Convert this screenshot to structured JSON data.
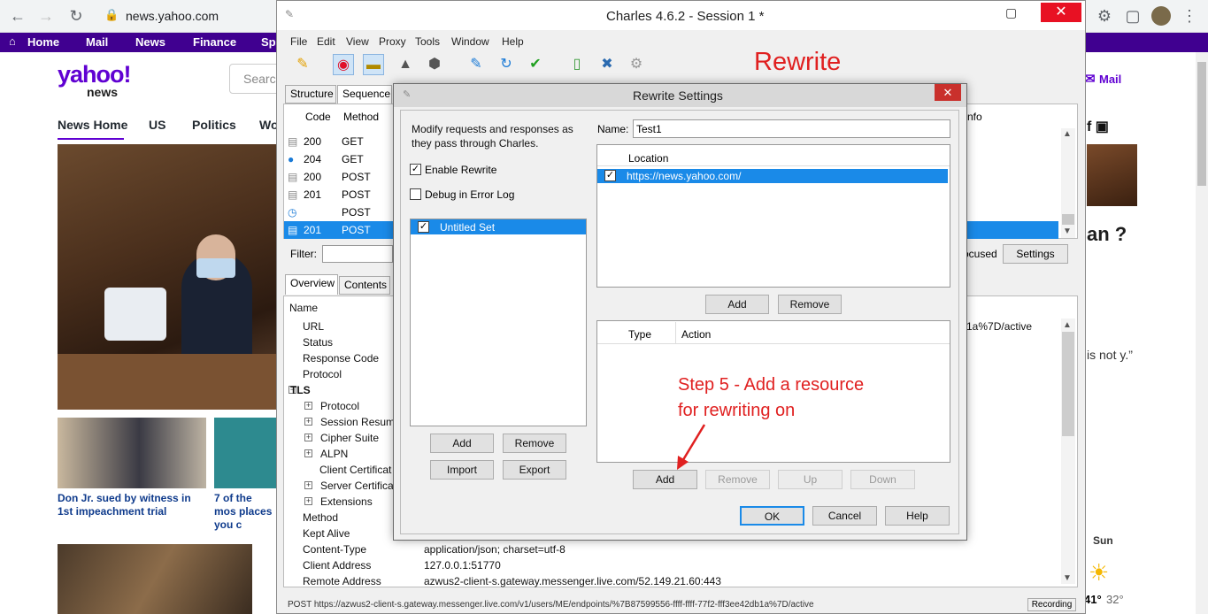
{
  "browser": {
    "url": "news.yahoo.com"
  },
  "yahoo": {
    "nav": [
      "Home",
      "Mail",
      "News",
      "Finance",
      "Sp"
    ],
    "logo": "yahoo!",
    "logo_sub": "news",
    "search_placeholder": "Searc",
    "subnav": [
      "News Home",
      "US",
      "Politics",
      "Wo"
    ],
    "captions": [
      "Don Jr. sued by witness in 1st impeachment trial",
      "7 of the mos places you c"
    ],
    "right": {
      "mail": "Mail",
      "headline": "an ?",
      "quote": "is not y.”",
      "day": "Sun",
      "high": "41°",
      "low": "32°"
    }
  },
  "charles": {
    "title": "Charles 4.6.2 - Session 1 *",
    "menu": [
      "File",
      "Edit",
      "View",
      "Proxy",
      "Tools",
      "Window",
      "Help"
    ],
    "annotation": "Rewrite",
    "tabs": [
      "Structure",
      "Sequence"
    ],
    "columns": [
      "Code",
      "Method"
    ],
    "right_col": "nfo",
    "rows": [
      {
        "code": "200",
        "method": "GET"
      },
      {
        "code": "204",
        "method": "GET"
      },
      {
        "code": "200",
        "method": "POST"
      },
      {
        "code": "201",
        "method": "POST"
      },
      {
        "code": "",
        "method": "POST"
      },
      {
        "code": "201",
        "method": "POST"
      }
    ],
    "filter_label": "Filter:",
    "focused_label": "ocused",
    "settings_label": "Settings",
    "detail_tabs": [
      "Overview",
      "Contents"
    ],
    "detail_header": "Name",
    "detail_items": [
      {
        "label": "URL",
        "value": "1a%7D/active",
        "indent": 1
      },
      {
        "label": "Status",
        "value": "",
        "indent": 1
      },
      {
        "label": "Response Code",
        "value": "",
        "indent": 1
      },
      {
        "label": "Protocol",
        "value": "",
        "indent": 1
      },
      {
        "label": "TLS",
        "value": "",
        "indent": 0
      },
      {
        "label": "Protocol",
        "value": "",
        "indent": 2
      },
      {
        "label": "Session Resume",
        "value": "",
        "indent": 2
      },
      {
        "label": "Cipher Suite",
        "value": "",
        "indent": 2
      },
      {
        "label": "ALPN",
        "value": "",
        "indent": 2
      },
      {
        "label": "Client Certificat",
        "value": "",
        "indent": 3
      },
      {
        "label": "Server Certificat",
        "value": "",
        "indent": 2
      },
      {
        "label": "Extensions",
        "value": "",
        "indent": 2
      },
      {
        "label": "Method",
        "value": "",
        "indent": 1
      },
      {
        "label": "Kept Alive",
        "value": "",
        "indent": 1
      },
      {
        "label": "Content-Type",
        "value": "application/json; charset=utf-8",
        "indent": 1
      },
      {
        "label": "Client Address",
        "value": "127.0.0.1:51770",
        "indent": 1
      },
      {
        "label": "Remote Address",
        "value": "azwus2-client-s.gateway.messenger.live.com/52.149.21.60:443",
        "indent": 1
      }
    ],
    "status_text": "POST https://azwus2-client-s.gateway.messenger.live.com/v1/users/ME/endpoints/%7B87599556-ffff-ffff-77f2-fff3ee42db1a%7D/active",
    "recording": "Recording"
  },
  "dialog": {
    "title": "Rewrite Settings",
    "description": "Modify requests and responses as they pass through Charles.",
    "enable_rewrite": "Enable Rewrite",
    "debug_log": "Debug in Error Log",
    "set_name": "Untitled Set",
    "add": "Add",
    "remove": "Remove",
    "import": "Import",
    "export": "Export",
    "name_label": "Name:",
    "name_value": "Test1",
    "location_header": "Location",
    "location_value": "https://news.yahoo.com/",
    "type_header": "Type",
    "action_header": "Action",
    "up": "Up",
    "down": "Down",
    "ok": "OK",
    "cancel": "Cancel",
    "help": "Help",
    "annotation_line1": "Step 5 - Add a resource",
    "annotation_line2": "for rewriting on"
  },
  "colors": {
    "yahoo_purple": "#6001d2",
    "nav_bg": "#400090",
    "selection": "#1a8ae8",
    "annotation": "#e02020"
  }
}
